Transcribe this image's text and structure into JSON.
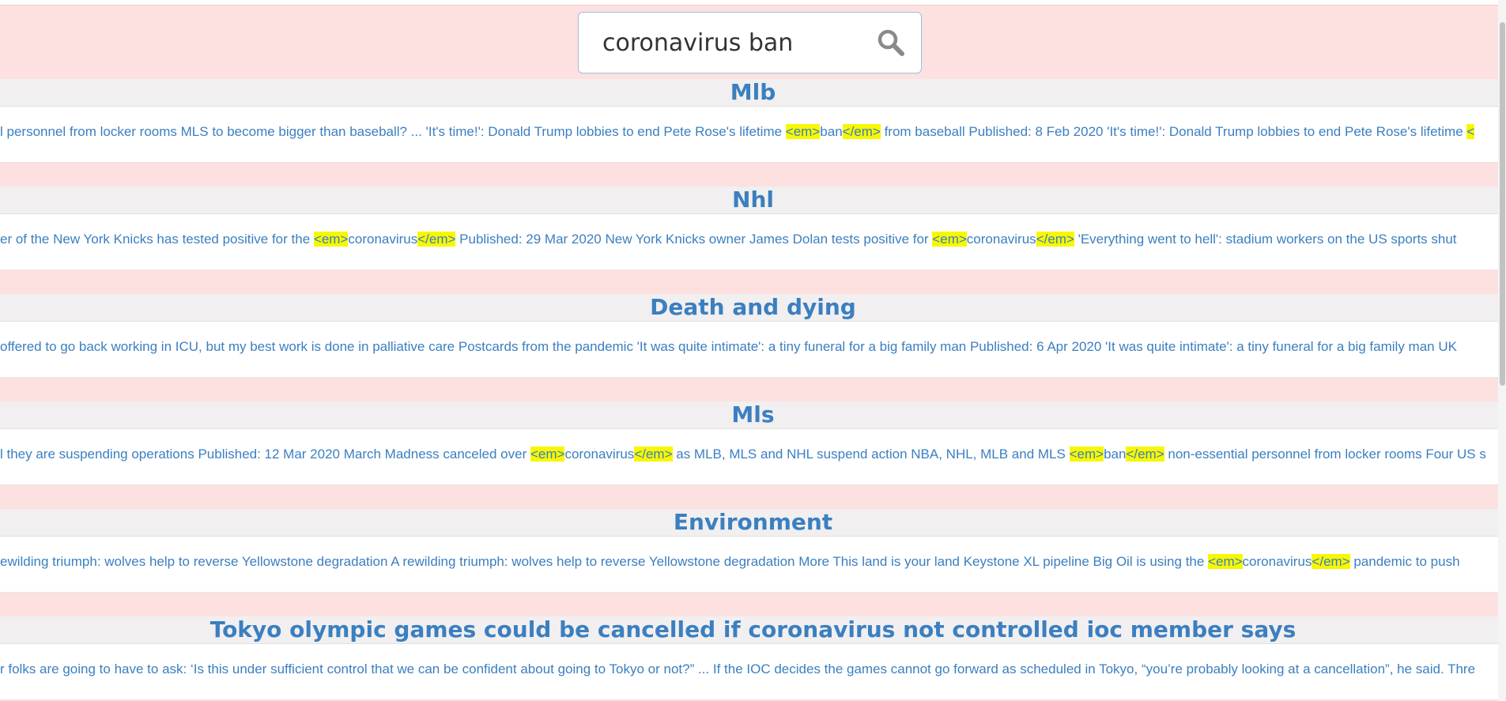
{
  "search": {
    "value": "coronavirus ban"
  },
  "colors": {
    "header_bg": "#fde0e0",
    "title_bg": "#f1eff0",
    "link": "#3b7fc0",
    "highlight": "#f7f700"
  },
  "results": [
    {
      "title": "Mlb",
      "snippet": [
        {
          "t": "l personnel from locker rooms MLS to become bigger than baseball? ... 'It's time!': Donald Trump lobbies to end Pete Rose's lifetime "
        },
        {
          "t": "<em>",
          "hl": true
        },
        {
          "t": "ban"
        },
        {
          "t": "</em>",
          "hl": true
        },
        {
          "t": " from baseball Published: 8 Feb 2020 'It's time!': Donald Trump lobbies to end Pete Rose's lifetime "
        },
        {
          "t": "<",
          "hl": true
        }
      ]
    },
    {
      "title": "Nhl",
      "snippet": [
        {
          "t": "er of the New York Knicks has tested positive for the "
        },
        {
          "t": "<em>",
          "hl": true
        },
        {
          "t": "coronavirus"
        },
        {
          "t": "</em>",
          "hl": true
        },
        {
          "t": " Published: 29 Mar 2020 New York Knicks owner James Dolan tests positive for "
        },
        {
          "t": "<em>",
          "hl": true
        },
        {
          "t": "coronavirus"
        },
        {
          "t": "</em>",
          "hl": true
        },
        {
          "t": " 'Everything went to hell': stadium workers on the US sports shut"
        }
      ]
    },
    {
      "title": "Death and dying",
      "snippet": [
        {
          "t": "offered to go back working in ICU, but my best work is done in palliative care Postcards from the pandemic 'It was quite intimate': a tiny funeral for a big family man Published: 6 Apr 2020 'It was quite intimate': a tiny funeral for a big family man UK"
        }
      ]
    },
    {
      "title": "Mls",
      "snippet": [
        {
          "t": "l they are suspending operations Published: 12 Mar 2020 March Madness canceled over "
        },
        {
          "t": "<em>",
          "hl": true
        },
        {
          "t": "coronavirus"
        },
        {
          "t": "</em>",
          "hl": true
        },
        {
          "t": " as MLB, MLS and NHL suspend action NBA, NHL, MLB and MLS "
        },
        {
          "t": "<em>",
          "hl": true
        },
        {
          "t": "ban"
        },
        {
          "t": "</em>",
          "hl": true
        },
        {
          "t": " non-essential personnel from locker rooms Four US s"
        }
      ]
    },
    {
      "title": "Environment",
      "snippet": [
        {
          "t": "ewilding triumph: wolves help to reverse Yellowstone degradation A rewilding triumph: wolves help to reverse Yellowstone degradation More This land is your land Keystone XL pipeline Big Oil is using the "
        },
        {
          "t": "<em>",
          "hl": true
        },
        {
          "t": "coronavirus"
        },
        {
          "t": "</em>",
          "hl": true
        },
        {
          "t": " pandemic to push"
        }
      ]
    },
    {
      "title": "Tokyo olympic games could be cancelled if coronavirus not controlled ioc member says",
      "snippet": [
        {
          "t": "r folks are going to have to ask: ‘Is this under sufficient control that we can be confident about going to Tokyo or not?” ... If the IOC decides the games cannot go forward as scheduled in Tokyo, “you’re probably looking at a cancellation”, he said. Thre"
        }
      ]
    }
  ]
}
